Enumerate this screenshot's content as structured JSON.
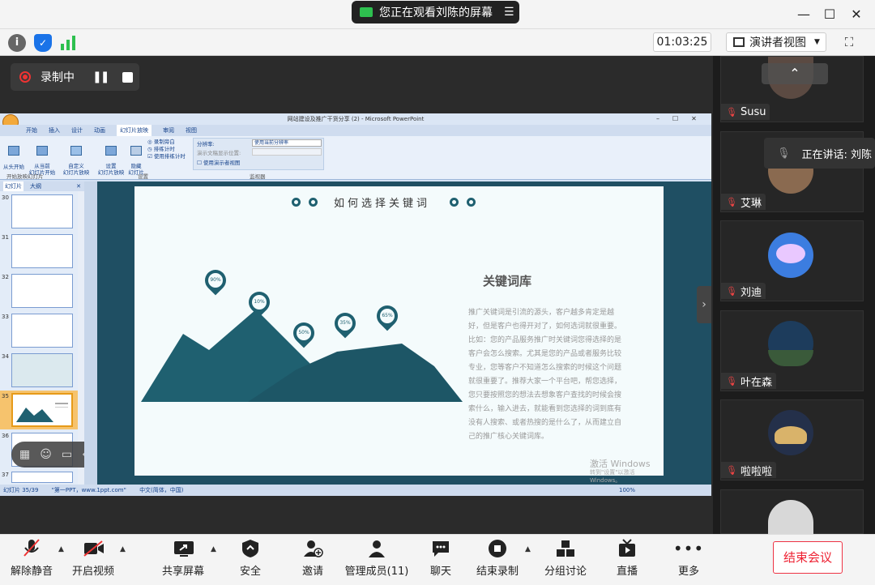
{
  "window": {
    "share_banner": "您正在观看刘陈的屏幕"
  },
  "toolbar": {
    "timer": "01:03:25",
    "view_label": "演讲者视图"
  },
  "recording": {
    "label": "录制中"
  },
  "ppt": {
    "title": "网站建设及推广干货分享 (2) - Microsoft PowerPoint",
    "tabs": [
      "开始",
      "插入",
      "设计",
      "动画",
      "幻灯片放映",
      "审阅",
      "视图"
    ],
    "ribbon_groups": [
      "开始放映幻灯片",
      "设置",
      "监视器"
    ],
    "ribbon_items": {
      "from_start": "从头开始",
      "from_current": "从当前\n幻灯片开始",
      "custom": "自定义\n幻灯片放映",
      "setup": "设置\n幻灯片放映",
      "hide": "隐藏\n幻灯片",
      "record": "录制旁白",
      "rehearse": "排练计时",
      "use_timing": "使用排练计时",
      "resolution": "分辨率:",
      "resolution_value": "使用当前分辨率",
      "show_on": "演示文稿显示位置:",
      "presenter_view": "使用演示者视图"
    },
    "pane_tabs": [
      "幻灯片",
      "大纲"
    ],
    "slide_numbers": [
      "30",
      "31",
      "32",
      "33",
      "34",
      "35",
      "36",
      "37"
    ],
    "status": {
      "slide": "幻灯片 35/39",
      "theme": "\"第一PPT，www.1ppt.com\"",
      "lang": "中文(简体，中国)",
      "zoom": "100%"
    }
  },
  "slide": {
    "heading": "如何选择关键词",
    "section_title": "关键词库",
    "body": "推广关键词是引流的源头，客户越多肯定是越好，但是客户也得开对了，如何选词就很重要。比如：您的产品服务推广时关键词您得选择的是客户会怎么搜索。尤其是您的产品或者服务比较专业，您等客户不知道怎么搜索的时候这个问题就很重要了。推荐大家一个平台吧，帮您选择，您只要按照您的想法去想象客户查找的时候会搜索什么，输入进去，就能看到您选择的词到底有没有人搜索、或者热搜的是什么了，从而建立自己的推广核心关键词库。",
    "pins": [
      "90%",
      "10%",
      "50%",
      "35%",
      "65%"
    ],
    "watermark_1": "激活 Windows",
    "watermark_2": "转到\"设置\"以激活 Windows。"
  },
  "participants": [
    {
      "name": "Susu"
    },
    {
      "name": "艾琳"
    },
    {
      "name": "刘迪"
    },
    {
      "name": "叶在森"
    },
    {
      "name": "啦啦啦"
    },
    {
      "name": ""
    }
  ],
  "speaker_popup": "正在讲话: 刘陈",
  "bottom": {
    "unmute": "解除静音",
    "video": "开启视频",
    "share": "共享屏幕",
    "security": "安全",
    "invite": "邀请",
    "manage": "管理成员(11)",
    "chat": "聊天",
    "stop_rec": "结束录制",
    "breakout": "分组讨论",
    "live": "直播",
    "more": "更多",
    "end": "结束会议"
  }
}
